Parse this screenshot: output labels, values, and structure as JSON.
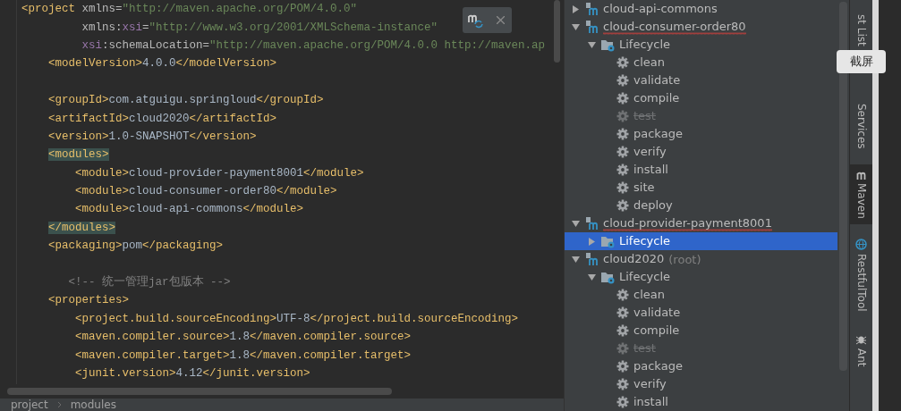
{
  "editor": {
    "lines": [
      {
        "tokens": [
          {
            "kind": "tag",
            "text": "<project "
          },
          {
            "kind": "attr",
            "text": "xmlns="
          },
          {
            "kind": "value",
            "text": "\"http://maven.apache.org/POM/4.0.0\""
          }
        ]
      },
      {
        "tokens": [
          {
            "kind": "attr",
            "text": "         xmlns:"
          },
          {
            "kind": "ns",
            "text": "xsi"
          },
          {
            "kind": "attr",
            "text": "="
          },
          {
            "kind": "value",
            "text": "\"http://www.w3.org/2001/XMLSchema-instance\""
          }
        ]
      },
      {
        "tokens": [
          {
            "kind": "ns",
            "text": "         xsi"
          },
          {
            "kind": "attr",
            "text": ":schemaLocation="
          },
          {
            "kind": "value",
            "text": "\"http://maven.apache.org/POM/4.0.0 http://maven.ap"
          }
        ]
      },
      {
        "tokens": [
          {
            "kind": "tag",
            "text": "    <modelVersion>"
          },
          {
            "kind": "text",
            "text": "4.0.0"
          },
          {
            "kind": "tag",
            "text": "</modelVersion>"
          }
        ]
      },
      {
        "kind": "blank"
      },
      {
        "tokens": [
          {
            "kind": "tag",
            "text": "    <groupId>"
          },
          {
            "kind": "text",
            "text": "com.atguigu.springloud"
          },
          {
            "kind": "tag",
            "text": "</groupId>"
          }
        ]
      },
      {
        "tokens": [
          {
            "kind": "tag",
            "text": "    <artifactId>"
          },
          {
            "kind": "text",
            "text": "cloud2020"
          },
          {
            "kind": "tag",
            "text": "</artifactId>"
          }
        ]
      },
      {
        "tokens": [
          {
            "kind": "tag",
            "text": "    <version>"
          },
          {
            "kind": "text",
            "text": "1.0-SNAPSHOT"
          },
          {
            "kind": "tag",
            "text": "</version>"
          }
        ]
      },
      {
        "tokens": [
          {
            "kind": "matched",
            "text": "    <modules>"
          }
        ]
      },
      {
        "tokens": [
          {
            "kind": "tag",
            "text": "        <module>"
          },
          {
            "kind": "text",
            "text": "cloud-provider-payment8001"
          },
          {
            "kind": "tag",
            "text": "</module>"
          }
        ]
      },
      {
        "tokens": [
          {
            "kind": "tag",
            "text": "        <module>"
          },
          {
            "kind": "text",
            "text": "cloud-consumer-order80"
          },
          {
            "kind": "tag",
            "text": "</module>"
          }
        ]
      },
      {
        "tokens": [
          {
            "kind": "tag",
            "text": "        <module>"
          },
          {
            "kind": "text",
            "text": "cloud-api-commons"
          },
          {
            "kind": "tag",
            "text": "</module>"
          }
        ]
      },
      {
        "tokens": [
          {
            "kind": "matched",
            "text": "    </modules>"
          }
        ]
      },
      {
        "tokens": [
          {
            "kind": "tag",
            "text": "    <packaging>"
          },
          {
            "kind": "text",
            "text": "pom"
          },
          {
            "kind": "tag",
            "text": "</packaging>"
          }
        ]
      },
      {
        "kind": "blank"
      },
      {
        "tokens": [
          {
            "kind": "comment",
            "text": "       <!-- 统一管理jar包版本 -->"
          }
        ]
      },
      {
        "tokens": [
          {
            "kind": "tag",
            "text": "    <properties>"
          }
        ]
      },
      {
        "tokens": [
          {
            "kind": "tag",
            "text": "        <project.build.sourceEncoding>"
          },
          {
            "kind": "text",
            "text": "UTF-8"
          },
          {
            "kind": "tag",
            "text": "</project.build.sourceEncoding>"
          }
        ]
      },
      {
        "tokens": [
          {
            "kind": "tag",
            "text": "        <maven.compiler.source>"
          },
          {
            "kind": "text",
            "text": "1.8"
          },
          {
            "kind": "tag",
            "text": "</maven.compiler.source>"
          }
        ]
      },
      {
        "tokens": [
          {
            "kind": "tag",
            "text": "        <maven.compiler.target>"
          },
          {
            "kind": "text",
            "text": "1.8"
          },
          {
            "kind": "tag",
            "text": "</maven.compiler.target>"
          }
        ]
      },
      {
        "tokens": [
          {
            "kind": "tag",
            "text": "        <junit.version>"
          },
          {
            "kind": "text",
            "text": "4.12"
          },
          {
            "kind": "tag",
            "text": "</junit.version>"
          }
        ]
      }
    ],
    "breadcrumbs": [
      "project",
      "modules"
    ]
  },
  "maven_tree": [
    {
      "label": "cloud-api-commons",
      "expanded": false,
      "misspelled": false
    },
    {
      "label": "cloud-consumer-order80",
      "expanded": true,
      "misspelled": true,
      "children": [
        {
          "label": "Lifecycle",
          "expanded": true,
          "selected": false,
          "children": [
            {
              "label": "clean",
              "disabled": false
            },
            {
              "label": "validate",
              "disabled": false
            },
            {
              "label": "compile",
              "disabled": false
            },
            {
              "label": "test",
              "disabled": true
            },
            {
              "label": "package",
              "disabled": false
            },
            {
              "label": "verify",
              "disabled": false
            },
            {
              "label": "install",
              "disabled": false
            },
            {
              "label": "site",
              "disabled": false
            },
            {
              "label": "deploy",
              "disabled": false
            }
          ]
        }
      ]
    },
    {
      "label": "cloud-provider-payment8001",
      "expanded": true,
      "misspelled": true,
      "children": [
        {
          "label": "Lifecycle",
          "expanded": false,
          "selected": true
        }
      ]
    },
    {
      "label": "cloud2020",
      "suffix": "(root)",
      "expanded": true,
      "misspelled": false,
      "children": [
        {
          "label": "Lifecycle",
          "expanded": true,
          "selected": false,
          "children": [
            {
              "label": "clean",
              "disabled": false
            },
            {
              "label": "validate",
              "disabled": false
            },
            {
              "label": "compile",
              "disabled": false
            },
            {
              "label": "test",
              "disabled": true
            },
            {
              "label": "package",
              "disabled": false
            },
            {
              "label": "verify",
              "disabled": false
            },
            {
              "label": "install",
              "disabled": false
            }
          ]
        }
      ]
    }
  ],
  "tool_tabs": [
    {
      "label": "st List",
      "kind": "plain",
      "selected": false
    },
    {
      "label": "Services",
      "kind": "plain",
      "selected": false
    },
    {
      "label": "Maven",
      "kind": "maven",
      "selected": true
    },
    {
      "label": "RestfulTool",
      "kind": "globe",
      "selected": false
    },
    {
      "label": "Ant",
      "kind": "bug",
      "selected": false
    }
  ],
  "tooltip": "截屏"
}
